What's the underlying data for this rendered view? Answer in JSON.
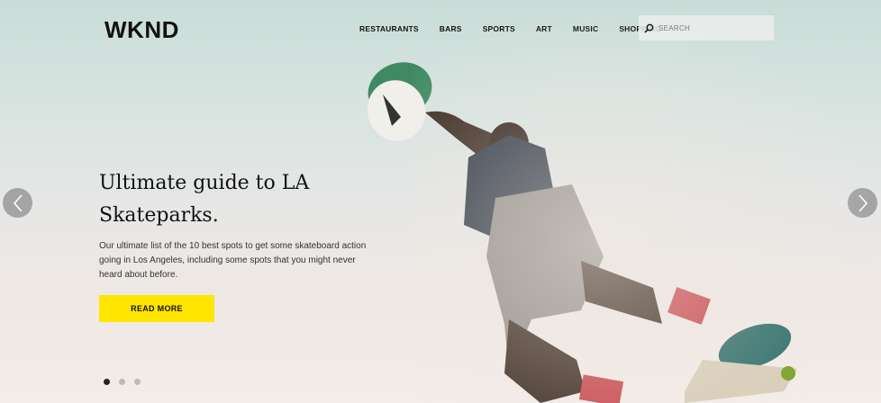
{
  "logo": "WKND",
  "nav": {
    "items": [
      "RESTAURANTS",
      "BARS",
      "SPORTS",
      "ART",
      "MUSIC",
      "SHOPPING"
    ]
  },
  "search": {
    "placeholder": "SEARCH",
    "icon": "search-icon"
  },
  "hero": {
    "headline": "Ultimate guide to LA Skateparks.",
    "description": "Our ultimate list of the 10 best spots to get some skateboard action going in Los Angeles, including some spots that you might never heard about before.",
    "cta_label": "READ MORE"
  },
  "carousel": {
    "slides": 3,
    "active": 0,
    "prev_icon": "chevron-left-icon",
    "next_icon": "chevron-right-icon"
  },
  "colors": {
    "cta": "#ffe600",
    "text": "#111111"
  }
}
